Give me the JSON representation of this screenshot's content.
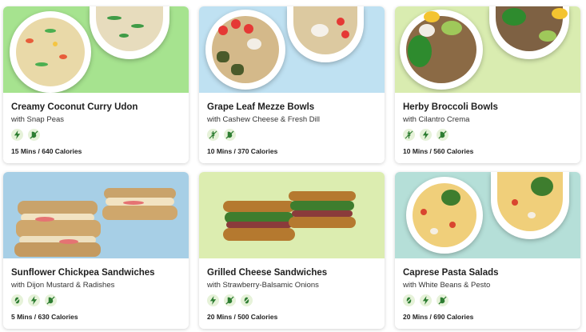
{
  "meals": [
    {
      "title": "Creamy Coconut Curry Udon",
      "subtitle": "with Snap Peas",
      "meta": "15 Mins / 640 Calories",
      "background": "#a6e38f",
      "icons": [
        "quick-icon",
        "no-dairy-icon"
      ]
    },
    {
      "title": "Grape Leaf Mezze Bowls",
      "subtitle": "with Cashew Cheese & Fresh Dill",
      "meta": "10 Mins / 370 Calories",
      "background": "#bfe1f2",
      "icons": [
        "no-gluten-icon",
        "no-dairy-icon"
      ]
    },
    {
      "title": "Herby Broccoli Bowls",
      "subtitle": "with Cilantro Crema",
      "meta": "10 Mins / 560 Calories",
      "background": "#d9ecb0",
      "icons": [
        "no-gluten-icon",
        "quick-icon",
        "no-dairy-icon"
      ]
    },
    {
      "title": "Sunflower Chickpea Sandwiches",
      "subtitle": "with Dijon Mustard & Radishes",
      "meta": "5 Mins / 630 Calories",
      "background": "#a7cfe6",
      "icons": [
        "no-nuts-icon",
        "quick-icon",
        "no-dairy-icon"
      ]
    },
    {
      "title": "Grilled Cheese Sandwiches",
      "subtitle": "with Strawberry-Balsamic Onions",
      "meta": "20 Mins / 500 Calories",
      "background": "#dcedb0",
      "icons": [
        "quick-icon",
        "no-dairy-icon",
        "no-nuts-icon"
      ]
    },
    {
      "title": "Caprese Pasta Salads",
      "subtitle": "with White Beans & Pesto",
      "meta": "20 Mins / 690 Calories",
      "background": "#b5dfd8",
      "icons": [
        "no-nuts-icon",
        "quick-icon",
        "no-dairy-icon"
      ]
    }
  ],
  "colors": {
    "badge_bg": "#e6f2d9",
    "icon_green": "#2e7d32"
  }
}
